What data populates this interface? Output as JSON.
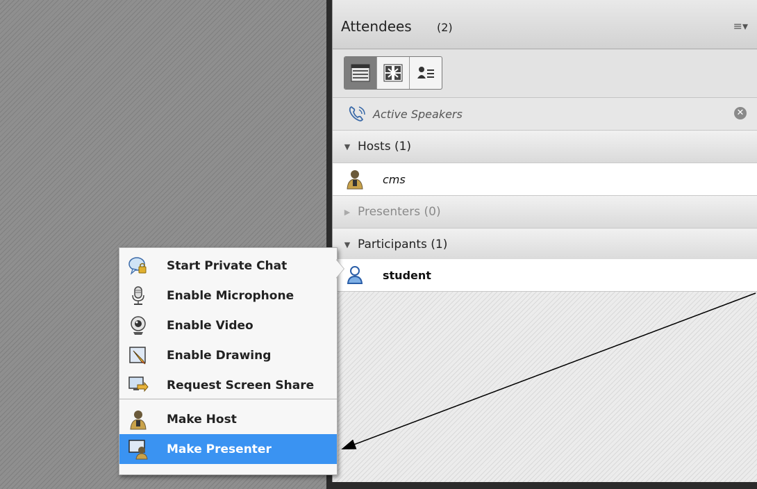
{
  "attendees_pod": {
    "title": "Attendees",
    "count": "(2)",
    "menu_glyph": "≡▾",
    "view_buttons": [
      {
        "icon": "list-view-icon",
        "active": true
      },
      {
        "icon": "grid-view-icon",
        "active": false
      },
      {
        "icon": "detail-view-icon",
        "active": false
      }
    ],
    "active_speakers_label": "Active Speakers",
    "close_glyph": "✕",
    "groups": {
      "hosts_label": "Hosts (1)",
      "presenters_label": "Presenters (0)",
      "participants_label": "Participants (1)"
    },
    "attendees": {
      "host_name": "cms",
      "participant_name": "student"
    },
    "expand_glyph": "▼",
    "collapse_glyph": "▶"
  },
  "context_menu": {
    "items": [
      {
        "label": "Start Private Chat",
        "icon": "private-chat-icon"
      },
      {
        "label": "Enable Microphone",
        "icon": "microphone-icon"
      },
      {
        "label": "Enable Video",
        "icon": "webcam-icon"
      },
      {
        "label": "Enable Drawing",
        "icon": "drawing-pencil-icon"
      },
      {
        "label": "Request Screen Share",
        "icon": "screen-share-icon"
      },
      {
        "label": "Make Host",
        "icon": "host-icon"
      },
      {
        "label": "Make Presenter",
        "icon": "presenter-icon",
        "selected": true
      }
    ],
    "highlight_color": "#3a93f2"
  }
}
